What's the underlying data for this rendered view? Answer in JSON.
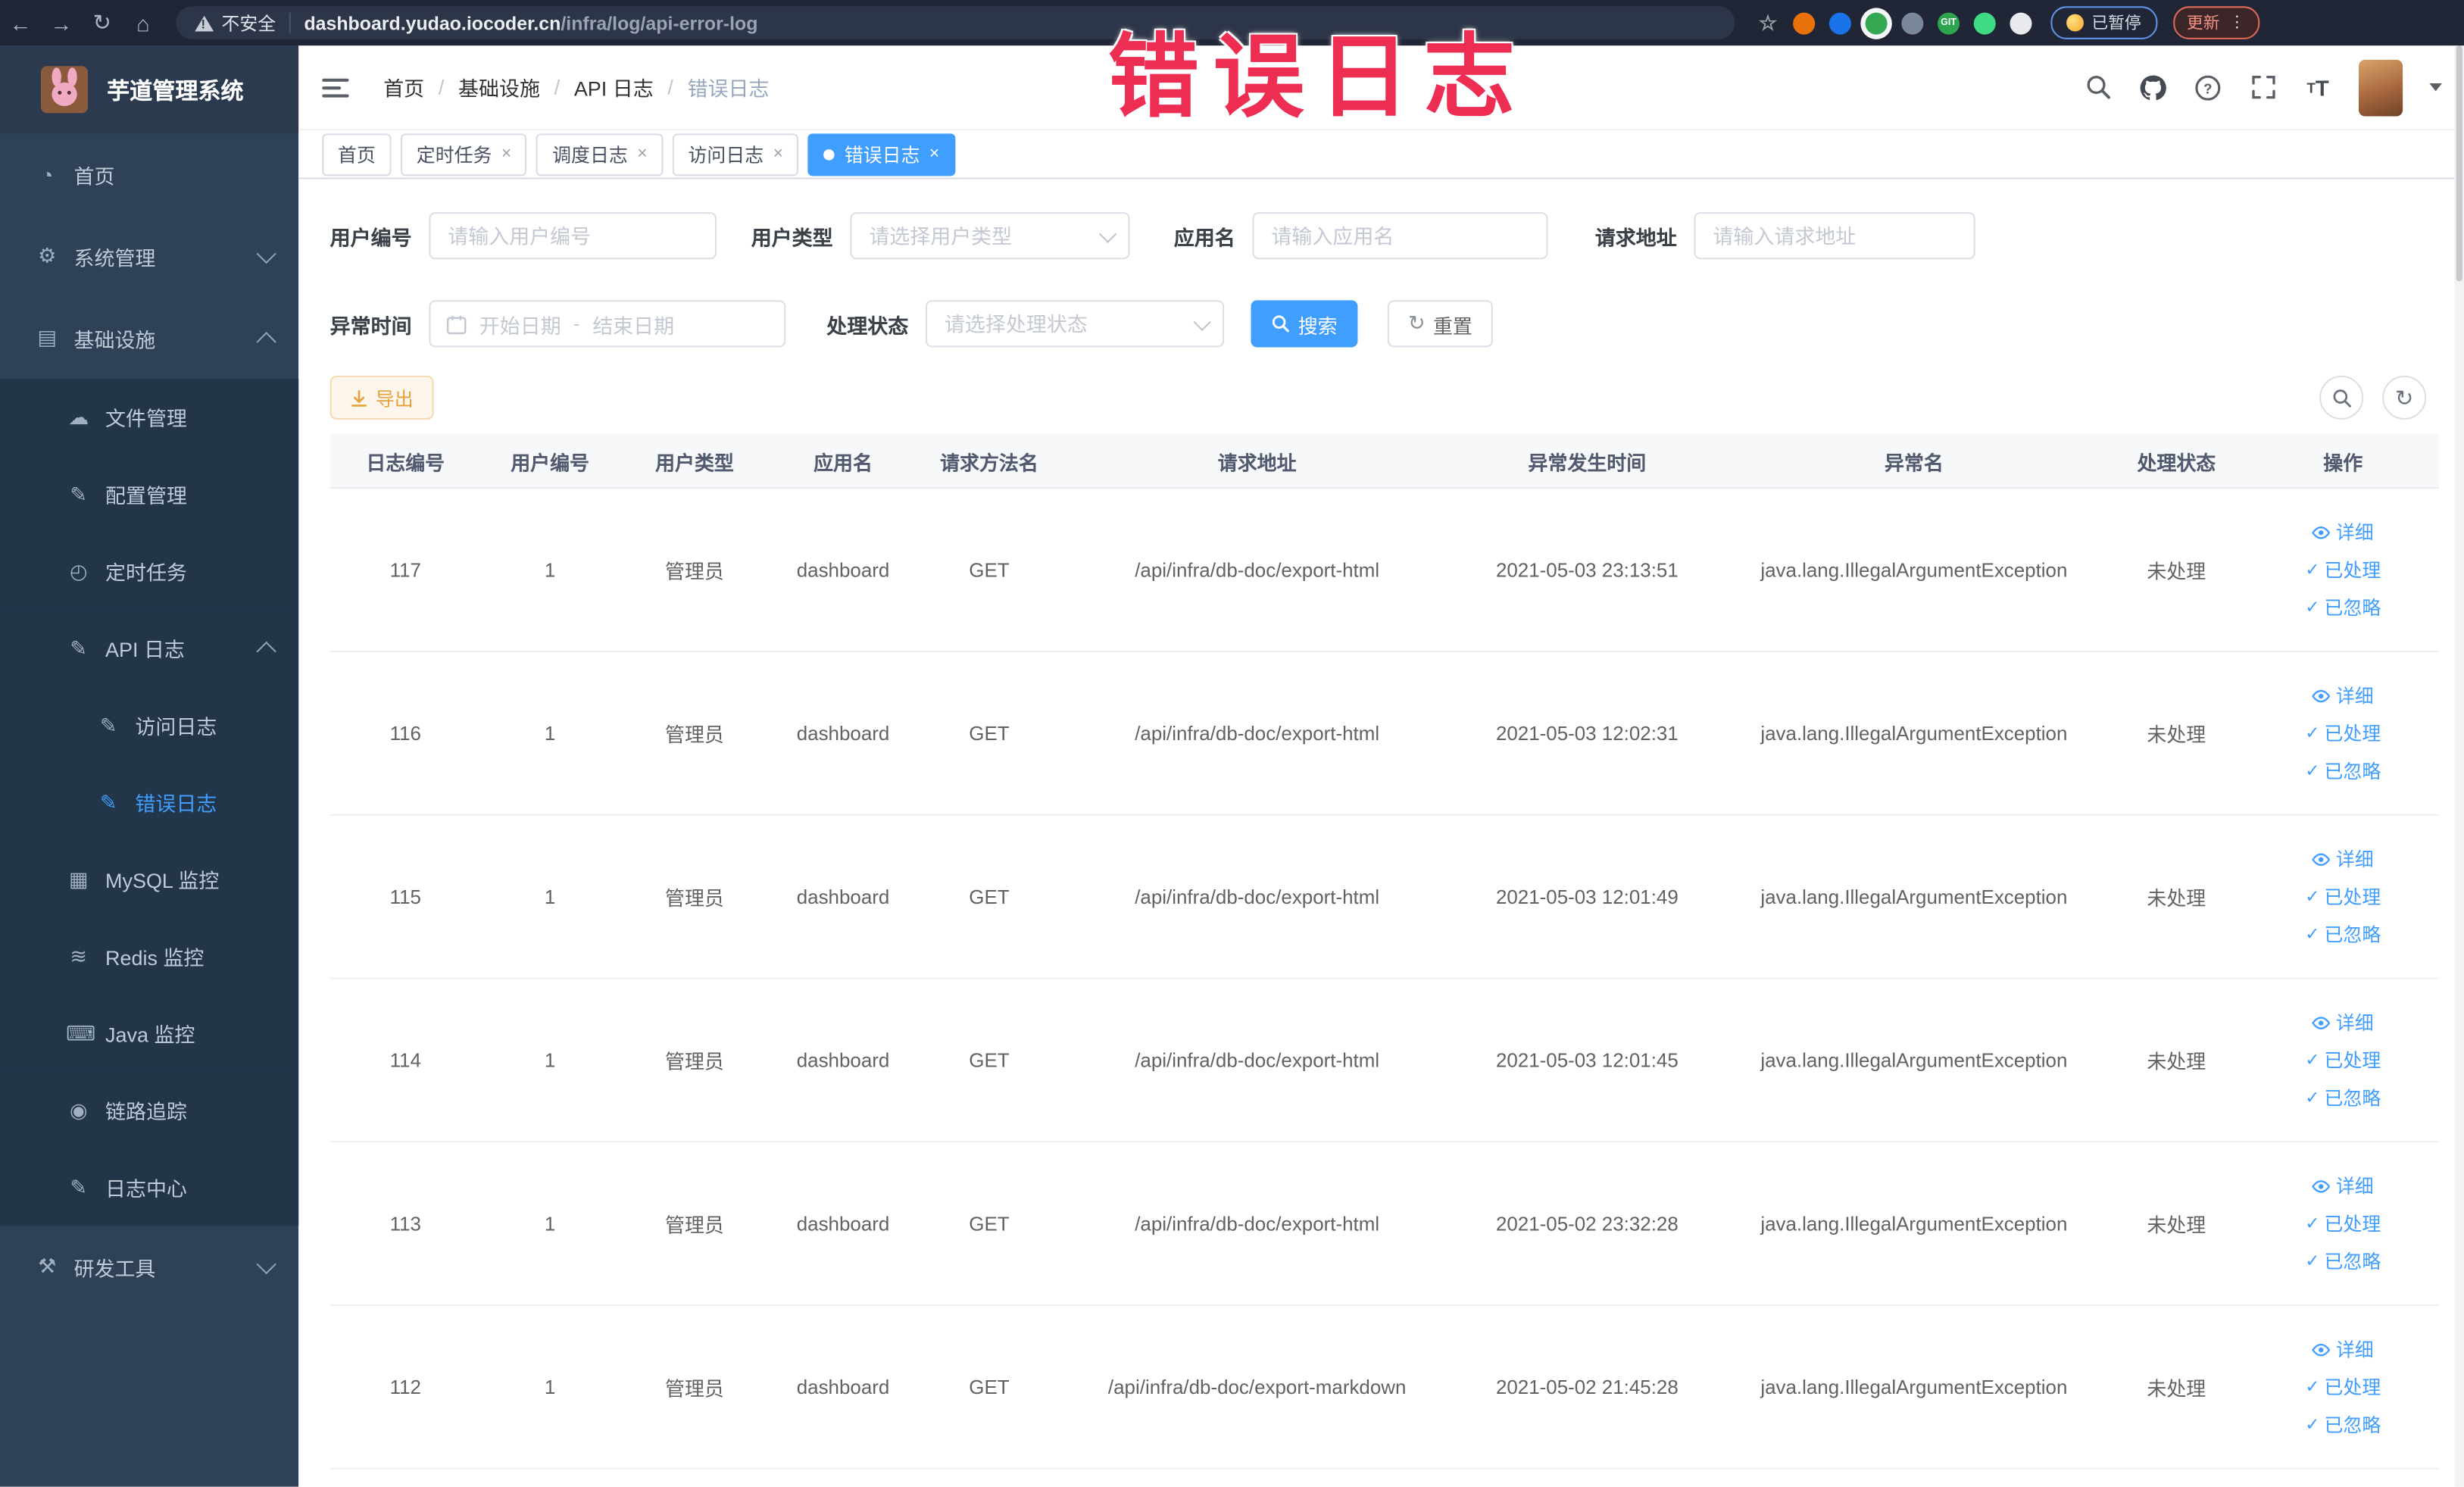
{
  "colors": {
    "accent": "#409eff",
    "overlay": "#ee2d52",
    "sidebar_bg": "#2e4156",
    "submenu_bg": "#223549",
    "active_tab_bg": "#409eff",
    "export_bg": "#fdf6ec",
    "export_text": "#e6a23c",
    "browser_bar": "#202636"
  },
  "overlay_title": "错误日志",
  "browser": {
    "security_label": "不安全",
    "url_host": "dashboard.yudao.iocoder.cn",
    "url_path": "/infra/log/api-error-log",
    "back_glyph": "←",
    "forward_glyph": "→",
    "reload_glyph": "↻",
    "home_glyph": "⌂",
    "paused_label": "已暂停",
    "update_label": "更新",
    "kebab_glyph": "⋮",
    "extensions": [
      {
        "key": "bookmark-star",
        "glyph": "☆"
      },
      {
        "key": "ext-orange",
        "color": "#e8710a"
      },
      {
        "key": "ext-blue",
        "color": "#1a73e8"
      },
      {
        "key": "ext-green",
        "color": "#34a853",
        "halo": true
      },
      {
        "key": "ext-grid",
        "color": "#7a869a"
      },
      {
        "key": "ext-git",
        "color": "#2da44e",
        "label": "GIT"
      },
      {
        "key": "ext-leaf",
        "color": "#3ddc84"
      },
      {
        "key": "ext-puzzle",
        "color": "#e8eaed"
      }
    ]
  },
  "sidebar": {
    "logo_title": "芋道管理系统",
    "items": [
      {
        "key": "home",
        "label": "首页",
        "glyph": "◔",
        "level": 1
      },
      {
        "key": "system-management",
        "label": "系统管理",
        "glyph": "⚙",
        "level": 1,
        "chevron": "down"
      },
      {
        "key": "infrastructure",
        "label": "基础设施",
        "glyph": "▤",
        "level": 1,
        "chevron": "up"
      },
      {
        "key": "file-management",
        "label": "文件管理",
        "glyph": "☁",
        "level": 2,
        "sub": true
      },
      {
        "key": "config-management",
        "label": "配置管理",
        "glyph": "✎",
        "level": 2,
        "sub": true
      },
      {
        "key": "scheduled-tasks",
        "label": "定时任务",
        "glyph": "◴",
        "level": 2,
        "sub": true
      },
      {
        "key": "api-log",
        "label": "API 日志",
        "glyph": "✎",
        "level": 2,
        "sub": true,
        "chevron": "up"
      },
      {
        "key": "access-log",
        "label": "访问日志",
        "glyph": "✎",
        "level": 3,
        "sub": true
      },
      {
        "key": "error-log",
        "label": "错误日志",
        "glyph": "✎",
        "level": 3,
        "sub": true,
        "active": true
      },
      {
        "key": "mysql-monitor",
        "label": "MySQL 监控",
        "glyph": "▦",
        "level": 2,
        "sub": true
      },
      {
        "key": "redis-monitor",
        "label": "Redis 监控",
        "glyph": "≋",
        "level": 2,
        "sub": true
      },
      {
        "key": "java-monitor",
        "label": "Java 监控",
        "glyph": "⌨",
        "level": 2,
        "sub": true
      },
      {
        "key": "trace",
        "label": "链路追踪",
        "glyph": "◉",
        "level": 2,
        "sub": true
      },
      {
        "key": "log-center",
        "label": "日志中心",
        "glyph": "✎",
        "level": 2,
        "sub": true
      },
      {
        "key": "dev-tools",
        "label": "研发工具",
        "glyph": "⚒",
        "level": 1,
        "chevron": "down"
      }
    ]
  },
  "header": {
    "breadcrumb": [
      "首页",
      "基础设施",
      "API 日志",
      "错误日志"
    ],
    "breadcrumb_separator": "/"
  },
  "tabs": [
    {
      "key": "home",
      "label": "首页",
      "closable": false,
      "active": false
    },
    {
      "key": "scheduled-tasks",
      "label": "定时任务",
      "closable": true,
      "active": false
    },
    {
      "key": "schedule-log",
      "label": "调度日志",
      "closable": true,
      "active": false
    },
    {
      "key": "access-log",
      "label": "访问日志",
      "closable": true,
      "active": false
    },
    {
      "key": "error-log",
      "label": "错误日志",
      "closable": true,
      "active": true
    }
  ],
  "filters": {
    "user_id_label": "用户编号",
    "user_id_placeholder": "请输入用户编号",
    "user_type_label": "用户类型",
    "user_type_placeholder": "请选择用户类型",
    "app_name_label": "应用名",
    "app_name_placeholder": "请输入应用名",
    "request_url_label": "请求地址",
    "request_url_placeholder": "请输入请求地址",
    "exception_time_label": "异常时间",
    "date_start_placeholder": "开始日期",
    "date_separator": "-",
    "date_end_placeholder": "结束日期",
    "process_status_label": "处理状态",
    "process_status_placeholder": "请选择处理状态",
    "search_label": "搜索",
    "reset_label": "重置"
  },
  "toolbar": {
    "export_label": "导出"
  },
  "table": {
    "columns": [
      "日志编号",
      "用户编号",
      "用户类型",
      "应用名",
      "请求方法名",
      "请求地址",
      "异常发生时间",
      "异常名",
      "处理状态",
      "操作"
    ],
    "row_actions": [
      {
        "key": "detail",
        "label": "详细",
        "icon": "eye-icon"
      },
      {
        "key": "processed",
        "label": "已处理",
        "icon": "check-icon"
      },
      {
        "key": "ignored",
        "label": "已忽略",
        "icon": "check-icon"
      }
    ],
    "rows": [
      {
        "log_id": "117",
        "user_id": "1",
        "user_type": "管理员",
        "app_name": "dashboard",
        "method": "GET",
        "url": "/api/infra/db-doc/export-html",
        "time": "2021-05-03 23:13:51",
        "exception": "java.lang.IllegalArgumentException",
        "status": "未处理"
      },
      {
        "log_id": "116",
        "user_id": "1",
        "user_type": "管理员",
        "app_name": "dashboard",
        "method": "GET",
        "url": "/api/infra/db-doc/export-html",
        "time": "2021-05-03 12:02:31",
        "exception": "java.lang.IllegalArgumentException",
        "status": "未处理"
      },
      {
        "log_id": "115",
        "user_id": "1",
        "user_type": "管理员",
        "app_name": "dashboard",
        "method": "GET",
        "url": "/api/infra/db-doc/export-html",
        "time": "2021-05-03 12:01:49",
        "exception": "java.lang.IllegalArgumentException",
        "status": "未处理"
      },
      {
        "log_id": "114",
        "user_id": "1",
        "user_type": "管理员",
        "app_name": "dashboard",
        "method": "GET",
        "url": "/api/infra/db-doc/export-html",
        "time": "2021-05-03 12:01:45",
        "exception": "java.lang.IllegalArgumentException",
        "status": "未处理"
      },
      {
        "log_id": "113",
        "user_id": "1",
        "user_type": "管理员",
        "app_name": "dashboard",
        "method": "GET",
        "url": "/api/infra/db-doc/export-html",
        "time": "2021-05-02 23:32:28",
        "exception": "java.lang.IllegalArgumentException",
        "status": "未处理"
      },
      {
        "log_id": "112",
        "user_id": "1",
        "user_type": "管理员",
        "app_name": "dashboard",
        "method": "GET",
        "url": "/api/infra/db-doc/export-markdown",
        "time": "2021-05-02 21:45:28",
        "exception": "java.lang.IllegalArgumentException",
        "status": "未处理"
      }
    ]
  }
}
